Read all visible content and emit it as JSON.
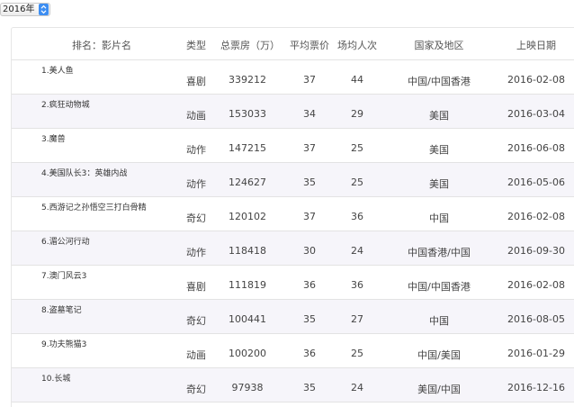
{
  "selector": {
    "year": "2016年"
  },
  "table": {
    "headers": {
      "rank_name": "排名：影片名",
      "type": "类型",
      "box_office": "总票房（万）",
      "avg_price": "平均票价",
      "avg_attendance": "场均人次",
      "region": "国家及地区",
      "release": "上映日期"
    },
    "rows": [
      {
        "name": "1.美人鱼",
        "type": "喜剧",
        "box_office": "339212",
        "avg_price": "37",
        "avg_attendance": "44",
        "region": "中国/中国香港",
        "release": "2016-02-08"
      },
      {
        "name": "2.疯狂动物城",
        "type": "动画",
        "box_office": "153033",
        "avg_price": "34",
        "avg_attendance": "29",
        "region": "美国",
        "release": "2016-03-04"
      },
      {
        "name": "3.魔兽",
        "type": "动作",
        "box_office": "147215",
        "avg_price": "37",
        "avg_attendance": "25",
        "region": "美国",
        "release": "2016-06-08"
      },
      {
        "name": "4.美国队长3：英雄内战",
        "type": "动作",
        "box_office": "124627",
        "avg_price": "35",
        "avg_attendance": "25",
        "region": "美国",
        "release": "2016-05-06"
      },
      {
        "name": "5.西游记之孙悟空三打白骨精",
        "type": "奇幻",
        "box_office": "120102",
        "avg_price": "37",
        "avg_attendance": "36",
        "region": "中国",
        "release": "2016-02-08"
      },
      {
        "name": "6.湄公河行动",
        "type": "动作",
        "box_office": "118418",
        "avg_price": "30",
        "avg_attendance": "24",
        "region": "中国香港/中国",
        "release": "2016-09-30"
      },
      {
        "name": "7.澳门风云3",
        "type": "喜剧",
        "box_office": "111819",
        "avg_price": "36",
        "avg_attendance": "36",
        "region": "中国/中国香港",
        "release": "2016-02-08"
      },
      {
        "name": "8.盗墓笔记",
        "type": "奇幻",
        "box_office": "100441",
        "avg_price": "35",
        "avg_attendance": "27",
        "region": "中国",
        "release": "2016-08-05"
      },
      {
        "name": "9.功夫熊猫3",
        "type": "动画",
        "box_office": "100200",
        "avg_price": "36",
        "avg_attendance": "25",
        "region": "中国/美国",
        "release": "2016-01-29"
      },
      {
        "name": "10.长城",
        "type": "奇幻",
        "box_office": "97938",
        "avg_price": "35",
        "avg_attendance": "24",
        "region": "美国/中国",
        "release": "2016-12-16"
      }
    ]
  },
  "colors": {
    "row_alt": "#f6f5fa",
    "selector_accent": "#3d8ef2"
  }
}
